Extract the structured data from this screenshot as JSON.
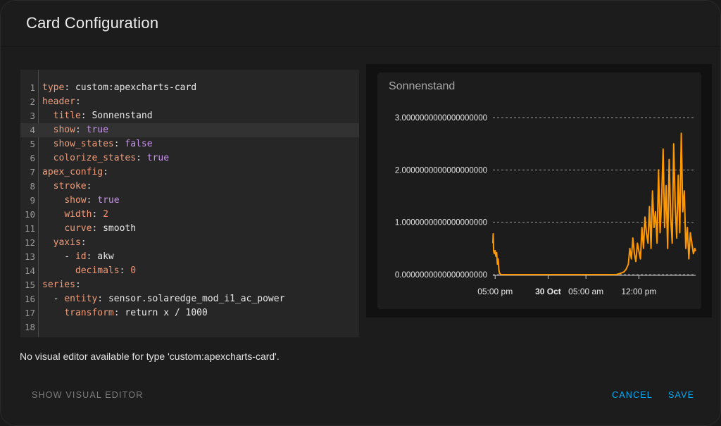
{
  "dialog": {
    "title": "Card Configuration"
  },
  "editor": {
    "active_line": 4,
    "lines": [
      {
        "n": "1",
        "segments": [
          [
            "k",
            "type"
          ],
          [
            "p",
            ": "
          ],
          [
            "s",
            "custom:apexcharts-card"
          ]
        ]
      },
      {
        "n": "2",
        "segments": [
          [
            "k",
            "header"
          ],
          [
            "p",
            ":"
          ]
        ]
      },
      {
        "n": "3",
        "segments": [
          [
            "p",
            "  "
          ],
          [
            "k",
            "title"
          ],
          [
            "p",
            ": "
          ],
          [
            "s",
            "Sonnenstand"
          ]
        ]
      },
      {
        "n": "4",
        "segments": [
          [
            "p",
            "  "
          ],
          [
            "k",
            "show"
          ],
          [
            "p",
            ": "
          ],
          [
            "b",
            "true"
          ]
        ]
      },
      {
        "n": "5",
        "segments": [
          [
            "p",
            "  "
          ],
          [
            "k",
            "show_states"
          ],
          [
            "p",
            ": "
          ],
          [
            "b",
            "false"
          ]
        ]
      },
      {
        "n": "6",
        "segments": [
          [
            "p",
            "  "
          ],
          [
            "k",
            "colorize_states"
          ],
          [
            "p",
            ": "
          ],
          [
            "b",
            "true"
          ]
        ]
      },
      {
        "n": "7",
        "segments": [
          [
            "k",
            "apex_config"
          ],
          [
            "p",
            ":"
          ]
        ]
      },
      {
        "n": "8",
        "segments": [
          [
            "p",
            "  "
          ],
          [
            "k",
            "stroke"
          ],
          [
            "p",
            ":"
          ]
        ]
      },
      {
        "n": "9",
        "segments": [
          [
            "p",
            "    "
          ],
          [
            "k",
            "show"
          ],
          [
            "p",
            ": "
          ],
          [
            "b",
            "true"
          ]
        ]
      },
      {
        "n": "10",
        "segments": [
          [
            "p",
            "    "
          ],
          [
            "k",
            "width"
          ],
          [
            "p",
            ": "
          ],
          [
            "n",
            "2"
          ]
        ]
      },
      {
        "n": "11",
        "segments": [
          [
            "p",
            "    "
          ],
          [
            "k",
            "curve"
          ],
          [
            "p",
            ": "
          ],
          [
            "s",
            "smooth"
          ]
        ]
      },
      {
        "n": "12",
        "segments": [
          [
            "p",
            "  "
          ],
          [
            "k",
            "yaxis"
          ],
          [
            "p",
            ":"
          ]
        ]
      },
      {
        "n": "13",
        "segments": [
          [
            "p",
            "    - "
          ],
          [
            "k",
            "id"
          ],
          [
            "p",
            ": "
          ],
          [
            "s",
            "akw"
          ]
        ]
      },
      {
        "n": "14",
        "segments": [
          [
            "p",
            "      "
          ],
          [
            "k",
            "decimals"
          ],
          [
            "p",
            ": "
          ],
          [
            "n",
            "0"
          ]
        ]
      },
      {
        "n": "15",
        "segments": [
          [
            "k",
            "series"
          ],
          [
            "p",
            ":"
          ]
        ]
      },
      {
        "n": "16",
        "segments": [
          [
            "p",
            "  - "
          ],
          [
            "k",
            "entity"
          ],
          [
            "p",
            ": "
          ],
          [
            "s",
            "sensor.solaredge_mod_i1_ac_power"
          ]
        ]
      },
      {
        "n": "17",
        "segments": [
          [
            "p",
            "    "
          ],
          [
            "k",
            "transform"
          ],
          [
            "p",
            ": "
          ],
          [
            "s",
            "return x / 1000"
          ]
        ]
      },
      {
        "n": "18",
        "segments": []
      }
    ]
  },
  "note": "No visual editor available for type 'custom:apexcharts-card'.",
  "buttons": {
    "show_visual_editor": "SHOW VISUAL EDITOR",
    "cancel": "CANCEL",
    "save": "SAVE"
  },
  "colors": {
    "accent": "#03a9f4",
    "series": "#ff9800"
  },
  "chart_data": {
    "type": "line",
    "title": "Sonnenstand",
    "ylim": [
      0,
      3
    ],
    "y_ticks": [
      {
        "value": 3,
        "label": "3.0000000000000000000"
      },
      {
        "value": 2,
        "label": "2.0000000000000000000"
      },
      {
        "value": 1,
        "label": "1.0000000000000000000"
      },
      {
        "value": 0,
        "label": "0.0000000000000000000"
      }
    ],
    "x_ticks": [
      {
        "h": 0,
        "label": "05:00 pm",
        "bold": false
      },
      {
        "h": 7,
        "label": "30 Oct",
        "bold": true
      },
      {
        "h": 12,
        "label": "05:00 am",
        "bold": false
      },
      {
        "h": 19,
        "label": "12:00 pm",
        "bold": false
      }
    ],
    "xlim_hours": [
      -0.3,
      26.5
    ],
    "grid": true,
    "series": [
      {
        "color": "#ff9800",
        "x": [
          -0.3,
          -0.25,
          -0.2,
          -0.1,
          0,
          0.1,
          0.2,
          0.3,
          0.4,
          0.5,
          0.6,
          0.8,
          1.0,
          2,
          4,
          6,
          8,
          10,
          12,
          14,
          15,
          15.5,
          16,
          16.5,
          17,
          17.3,
          17.6,
          17.8,
          18,
          18.2,
          18.4,
          18.6,
          18.8,
          19,
          19.2,
          19.4,
          19.6,
          19.8,
          20,
          20.2,
          20.4,
          20.6,
          20.8,
          21,
          21.2,
          21.4,
          21.6,
          21.8,
          22,
          22.2,
          22.4,
          22.6,
          22.8,
          23,
          23.2,
          23.4,
          23.6,
          23.8,
          24,
          24.2,
          24.4,
          24.6,
          24.8,
          25,
          25.2,
          25.4,
          25.6,
          25.8,
          26,
          26.2,
          26.4,
          26.5
        ],
        "y": [
          0.6,
          0.78,
          0.45,
          0.4,
          0.46,
          0.35,
          0.42,
          0.2,
          0.3,
          0.08,
          0.02,
          0,
          0,
          0,
          0,
          0,
          0,
          0,
          0,
          0,
          0,
          0,
          0,
          0.02,
          0.05,
          0.1,
          0.2,
          0.5,
          0.3,
          0.7,
          0.4,
          0.25,
          0.6,
          0.45,
          0.3,
          0.9,
          0.5,
          1.1,
          0.8,
          0.6,
          1.3,
          0.5,
          1.6,
          0.9,
          1.2,
          0.6,
          2.0,
          0.8,
          1.4,
          2.4,
          0.9,
          1.7,
          0.5,
          2.2,
          1.1,
          0.6,
          2.5,
          1.3,
          0.7,
          1.9,
          0.8,
          2.7,
          1.2,
          1.6,
          0.5,
          0.9,
          0.3,
          0.8,
          0.6,
          0.4,
          0.5,
          0.45
        ]
      }
    ]
  }
}
